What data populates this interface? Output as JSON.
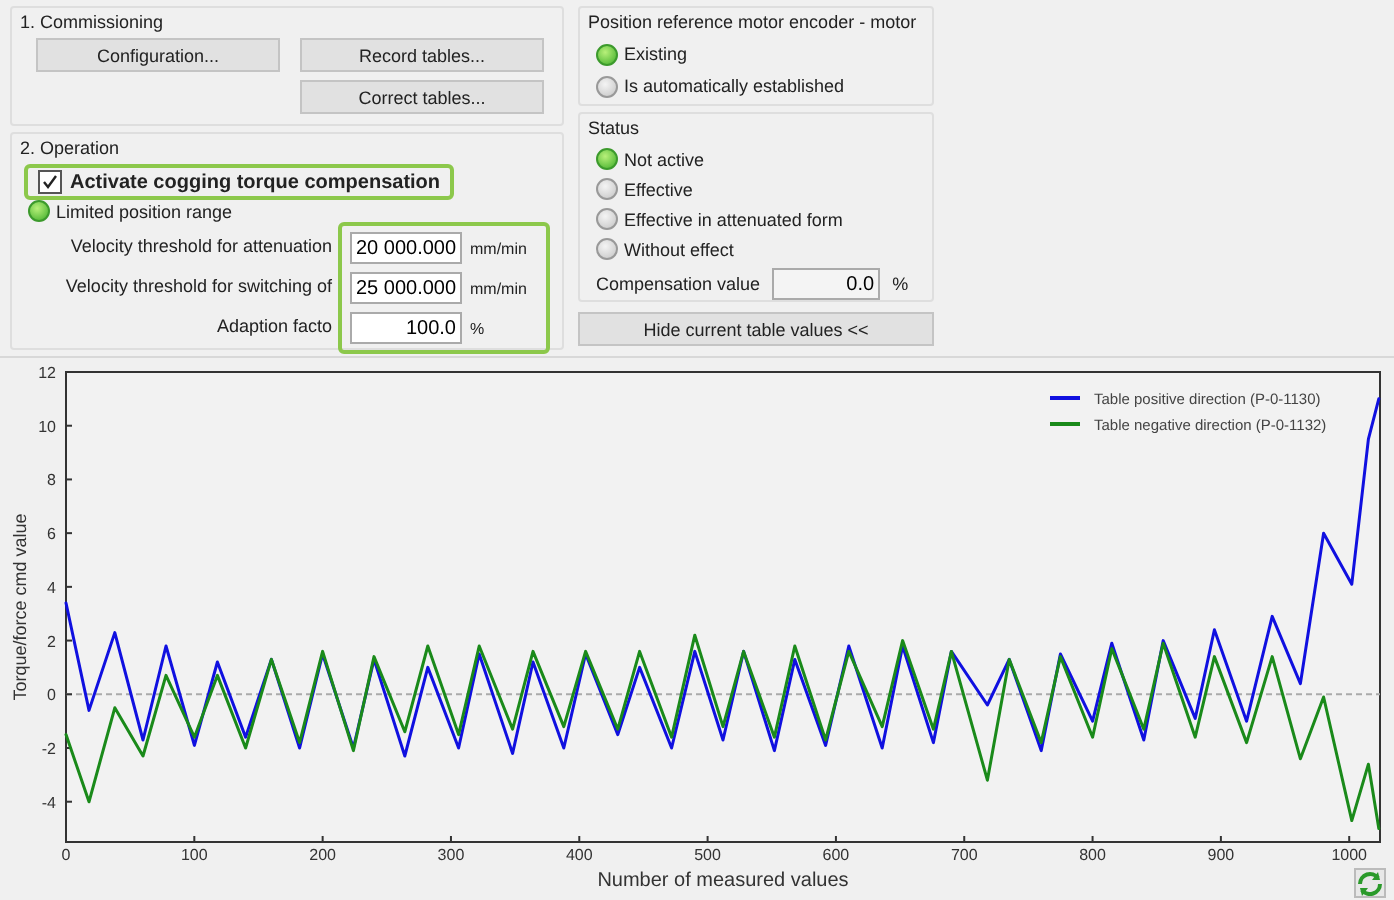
{
  "commissioning": {
    "title": "1. Commissioning",
    "buttons": [
      {
        "label": "Configuration..."
      },
      {
        "label": "Record tables..."
      },
      {
        "label": "Correct tables..."
      }
    ]
  },
  "operation": {
    "title": "2. Operation",
    "checkbox": {
      "label": "Activate cogging torque compensation",
      "checked": true
    },
    "indicator": {
      "label": "Limited position range",
      "on": true
    },
    "fields": [
      {
        "label": "Velocity threshold for attenuation",
        "value": "20 000.000",
        "unit": "mm/min"
      },
      {
        "label": "Velocity threshold for switching of",
        "value": "25 000.000",
        "unit": "mm/min"
      },
      {
        "label": "Adaption facto",
        "value": "100.0",
        "unit": "%"
      }
    ]
  },
  "position_reference": {
    "title": "Position reference motor encoder - motor",
    "options": [
      {
        "label": "Existing",
        "selected": true
      },
      {
        "label": "Is automatically established",
        "selected": false
      }
    ]
  },
  "status": {
    "title": "Status",
    "options": [
      {
        "label": "Not active",
        "selected": true
      },
      {
        "label": "Effective",
        "selected": false
      },
      {
        "label": "Effective in attenuated form",
        "selected": false
      },
      {
        "label": "Without effect",
        "selected": false
      }
    ],
    "compensation": {
      "label": "Compensation value",
      "value": "0.0",
      "unit": "%"
    }
  },
  "hide_button": {
    "label": "Hide current table values <<"
  },
  "chart": {
    "chart_data": {
      "type": "line",
      "legend": "upper right",
      "xlabel": "Number of measured values",
      "ylabel": "Torque/force cmd value",
      "xlim": [
        0,
        1024
      ],
      "ylim": [
        -5.5,
        12
      ],
      "xticks": [
        0,
        100,
        200,
        300,
        400,
        500,
        600,
        700,
        800,
        900,
        1000
      ],
      "yticks": [
        -4,
        -2,
        0,
        2,
        4,
        6,
        8,
        10,
        12
      ],
      "x": [
        0,
        18,
        38,
        60,
        78,
        100,
        118,
        140,
        160,
        182,
        200,
        224,
        240,
        264,
        282,
        306,
        322,
        348,
        364,
        388,
        405,
        430,
        447,
        472,
        490,
        512,
        528,
        552,
        568,
        592,
        610,
        636,
        652,
        676,
        690,
        718,
        735,
        760,
        775,
        800,
        815,
        840,
        855,
        880,
        895,
        920,
        940,
        962,
        980,
        1002,
        1015,
        1023
      ],
      "series": [
        {
          "name": "Table positive direction (P-0-1130)",
          "color": "#1010e0",
          "values": [
            3.4,
            -0.6,
            2.3,
            -1.7,
            1.8,
            -1.9,
            1.2,
            -1.6,
            1.3,
            -2.0,
            1.5,
            -2.0,
            1.3,
            -2.3,
            1.0,
            -2.0,
            1.5,
            -2.2,
            1.2,
            -2.0,
            1.5,
            -1.5,
            1.0,
            -2.0,
            1.6,
            -1.7,
            1.6,
            -2.1,
            1.3,
            -1.9,
            1.8,
            -2.0,
            1.8,
            -1.8,
            1.6,
            -0.4,
            1.3,
            -2.1,
            1.5,
            -1.0,
            1.9,
            -1.7,
            2.0,
            -0.9,
            2.4,
            -1.0,
            2.9,
            0.4,
            6.0,
            4.1,
            9.5,
            11.0
          ]
        },
        {
          "name": "Table negative direction (P-0-1132)",
          "color": "#1a8a1a",
          "values": [
            -1.5,
            -4.0,
            -0.5,
            -2.3,
            0.7,
            -1.6,
            0.7,
            -2.0,
            1.3,
            -1.8,
            1.6,
            -2.1,
            1.4,
            -1.4,
            1.8,
            -1.5,
            1.8,
            -1.3,
            1.6,
            -1.2,
            1.6,
            -1.3,
            1.6,
            -1.6,
            2.2,
            -1.2,
            1.6,
            -1.6,
            1.8,
            -1.7,
            1.6,
            -1.2,
            2.0,
            -1.3,
            1.6,
            -3.2,
            1.3,
            -1.8,
            1.4,
            -1.6,
            1.7,
            -1.3,
            1.9,
            -1.6,
            1.4,
            -1.8,
            1.4,
            -2.4,
            -0.1,
            -4.7,
            -2.6,
            -5.0
          ]
        }
      ]
    }
  }
}
